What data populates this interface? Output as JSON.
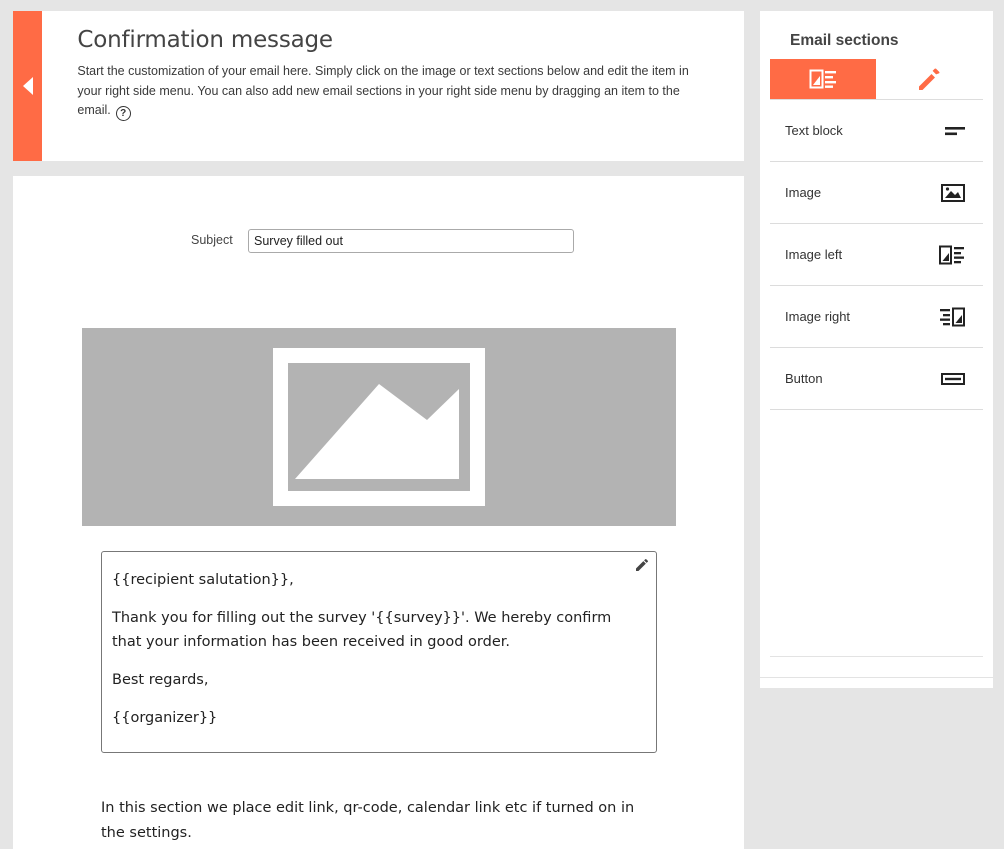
{
  "header": {
    "title": "Confirmation message",
    "description": "Start the customization of your email here. Simply click on the image or text sections below and edit the item in your right side menu. You can also add new email sections in your right side menu by dragging an item to the email.",
    "help_icon": "?",
    "collapse_icon": "triangle-left-icon"
  },
  "email": {
    "subject_label": "Subject",
    "subject_value": "Survey filled out",
    "image_icon": "image-placeholder-icon",
    "text_block": {
      "salutation": "{{recipient salutation}},",
      "body": "Thank you for filling out the survey '{{survey}}'. We hereby confirm that your information has been received in good order.",
      "closing": "Best regards,",
      "signature": "{{organizer}}"
    },
    "footer_note": "In this section we place edit link, qr-code, calendar link etc if turned on in the settings."
  },
  "sidebar": {
    "title": "Email sections",
    "tabs": [
      {
        "icon": "sections-icon",
        "active": true
      },
      {
        "icon": "pencil-icon",
        "active": false
      }
    ],
    "items": [
      {
        "label": "Text block",
        "icon": "text-block-icon"
      },
      {
        "label": "Image",
        "icon": "image-icon"
      },
      {
        "label": "Image left",
        "icon": "image-left-icon"
      },
      {
        "label": "Image right",
        "icon": "image-right-icon"
      },
      {
        "label": "Button",
        "icon": "button-icon"
      }
    ]
  },
  "colors": {
    "accent": "#ff6b45",
    "background": "#e5e5e5",
    "placeholder": "#b3b3b3"
  }
}
